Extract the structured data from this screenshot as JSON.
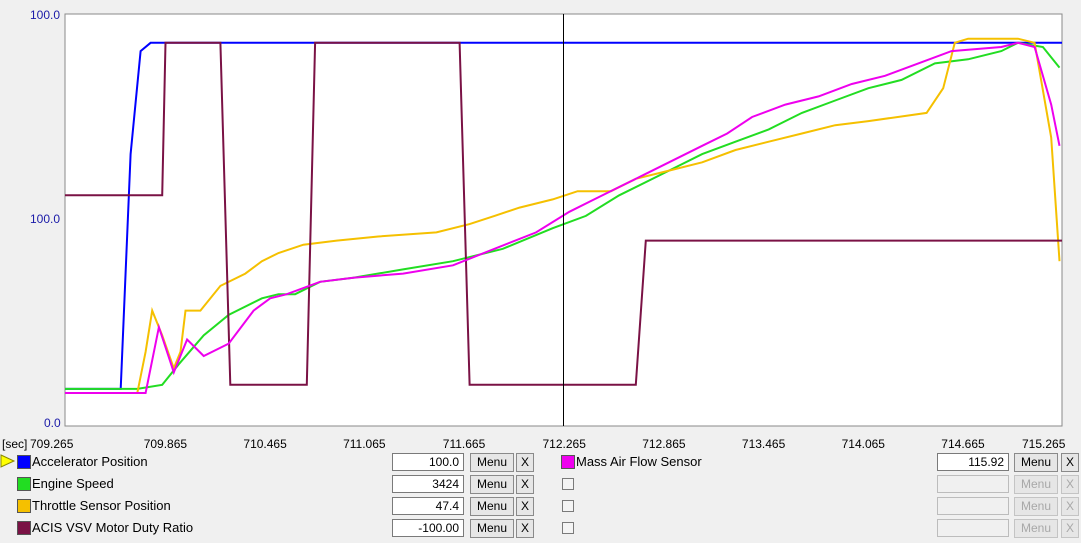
{
  "chart": {
    "y_labels": {
      "top": "100.0",
      "mid": "100.0",
      "bottom": "0.0"
    },
    "x_unit": "[sec]",
    "x_ticks": [
      "709.265",
      "709.865",
      "710.465",
      "711.065",
      "711.665",
      "712.265",
      "712.865",
      "713.465",
      "714.065",
      "714.665",
      "715.265"
    ],
    "colors": {
      "accelerator": "#0000ff",
      "engine": "#22dd22",
      "throttle": "#f5c000",
      "acis": "#7a1245",
      "maf": "#ee00ee",
      "cursor": "#000000"
    }
  },
  "chart_data": {
    "type": "line",
    "xlabel": "[sec]",
    "xlim": [
      709.265,
      715.265
    ],
    "x_ticks": [
      709.265,
      709.865,
      710.465,
      711.065,
      711.665,
      712.265,
      712.865,
      713.465,
      714.065,
      714.665,
      715.265
    ],
    "y_tick_labels": [
      "100.0",
      "100.0",
      "0.0"
    ],
    "cursor_x": 712.265,
    "series": [
      {
        "name": "Accelerator Position",
        "color": "#0000ff",
        "points": [
          [
            709.265,
            9
          ],
          [
            709.6,
            9
          ],
          [
            709.66,
            66
          ],
          [
            709.72,
            91
          ],
          [
            709.78,
            93
          ],
          [
            710.5,
            93
          ],
          [
            713.0,
            93
          ],
          [
            715.265,
            93
          ]
        ]
      },
      {
        "name": "Engine Speed",
        "color": "#22dd22",
        "points": [
          [
            709.265,
            9
          ],
          [
            709.7,
            9
          ],
          [
            709.85,
            10
          ],
          [
            709.95,
            15
          ],
          [
            710.1,
            22
          ],
          [
            710.25,
            27
          ],
          [
            710.45,
            31
          ],
          [
            710.55,
            32
          ],
          [
            710.65,
            32
          ],
          [
            710.8,
            35
          ],
          [
            711.0,
            36
          ],
          [
            711.3,
            38
          ],
          [
            711.6,
            40
          ],
          [
            711.9,
            43
          ],
          [
            712.2,
            48
          ],
          [
            712.4,
            51
          ],
          [
            712.6,
            56
          ],
          [
            712.9,
            62
          ],
          [
            713.1,
            66
          ],
          [
            713.3,
            69
          ],
          [
            713.5,
            72
          ],
          [
            713.7,
            76
          ],
          [
            713.9,
            79
          ],
          [
            714.1,
            82
          ],
          [
            714.3,
            84
          ],
          [
            714.5,
            88
          ],
          [
            714.7,
            89
          ],
          [
            714.9,
            91
          ],
          [
            715.0,
            93
          ],
          [
            715.15,
            92
          ],
          [
            715.25,
            87
          ]
        ]
      },
      {
        "name": "Throttle Sensor Position",
        "color": "#f5c000",
        "points": [
          [
            709.265,
            8
          ],
          [
            709.7,
            8
          ],
          [
            709.75,
            18
          ],
          [
            709.79,
            28
          ],
          [
            709.85,
            22
          ],
          [
            709.92,
            14
          ],
          [
            709.96,
            18
          ],
          [
            709.99,
            28
          ],
          [
            710.08,
            28
          ],
          [
            710.2,
            34
          ],
          [
            710.35,
            37
          ],
          [
            710.45,
            40
          ],
          [
            710.55,
            42
          ],
          [
            710.7,
            44
          ],
          [
            710.9,
            45
          ],
          [
            711.15,
            46
          ],
          [
            711.5,
            47
          ],
          [
            711.7,
            49
          ],
          [
            711.85,
            51
          ],
          [
            712.0,
            53
          ],
          [
            712.2,
            55
          ],
          [
            712.35,
            57
          ],
          [
            712.55,
            57
          ],
          [
            712.7,
            60
          ],
          [
            712.9,
            62
          ],
          [
            713.1,
            64
          ],
          [
            713.3,
            67
          ],
          [
            713.5,
            69
          ],
          [
            713.7,
            71
          ],
          [
            713.9,
            73
          ],
          [
            714.1,
            74
          ],
          [
            714.45,
            76
          ],
          [
            714.55,
            82
          ],
          [
            714.62,
            93
          ],
          [
            714.7,
            94
          ],
          [
            715.0,
            94
          ],
          [
            715.1,
            93
          ],
          [
            715.2,
            70
          ],
          [
            715.25,
            40
          ]
        ]
      },
      {
        "name": "ACIS VSV Motor Duty Ratio",
        "color": "#7a1245",
        "points": [
          [
            709.265,
            56
          ],
          [
            709.85,
            56
          ],
          [
            709.87,
            93
          ],
          [
            710.2,
            93
          ],
          [
            710.26,
            10
          ],
          [
            710.72,
            10
          ],
          [
            710.77,
            93
          ],
          [
            711.64,
            93
          ],
          [
            711.7,
            10
          ],
          [
            712.7,
            10
          ],
          [
            712.76,
            45
          ],
          [
            715.265,
            45
          ]
        ]
      },
      {
        "name": "Mass Air Flow Sensor",
        "color": "#ee00ee",
        "points": [
          [
            709.265,
            8
          ],
          [
            709.75,
            8
          ],
          [
            709.83,
            24
          ],
          [
            709.92,
            13
          ],
          [
            710.0,
            21
          ],
          [
            710.1,
            17
          ],
          [
            710.25,
            20
          ],
          [
            710.4,
            28
          ],
          [
            710.5,
            31
          ],
          [
            710.6,
            32
          ],
          [
            710.8,
            35
          ],
          [
            711.0,
            36
          ],
          [
            711.3,
            37
          ],
          [
            711.6,
            39
          ],
          [
            711.85,
            43
          ],
          [
            712.1,
            47
          ],
          [
            712.3,
            52
          ],
          [
            712.45,
            55
          ],
          [
            712.6,
            58
          ],
          [
            712.75,
            61
          ],
          [
            712.9,
            64
          ],
          [
            713.1,
            68
          ],
          [
            713.25,
            71
          ],
          [
            713.4,
            75
          ],
          [
            713.6,
            78
          ],
          [
            713.8,
            80
          ],
          [
            714.0,
            83
          ],
          [
            714.2,
            85
          ],
          [
            714.4,
            88
          ],
          [
            714.6,
            91
          ],
          [
            714.9,
            92
          ],
          [
            715.0,
            93
          ],
          [
            715.1,
            92
          ],
          [
            715.2,
            78
          ],
          [
            715.25,
            68
          ]
        ]
      }
    ]
  },
  "legend": {
    "left_rows": [
      {
        "label": "Accelerator Position",
        "value": "100.0",
        "menu": "Menu",
        "close": "X",
        "color": "#0000ff"
      },
      {
        "label": "Engine Speed",
        "value": "3424",
        "menu": "Menu",
        "close": "X",
        "color": "#22dd22"
      },
      {
        "label": "Throttle Sensor Position",
        "value": "47.4",
        "menu": "Menu",
        "close": "X",
        "color": "#f5c000"
      },
      {
        "label": "ACIS VSV Motor Duty Ratio",
        "value": "-100.00",
        "menu": "Menu",
        "close": "X",
        "color": "#7a1245"
      }
    ],
    "right_rows": [
      {
        "label": "Mass Air Flow Sensor",
        "value": "115.92",
        "menu": "Menu",
        "close": "X",
        "color": "#ee00ee",
        "enabled": true
      },
      {
        "label": "",
        "value": "",
        "menu": "Menu",
        "close": "X",
        "enabled": false
      },
      {
        "label": "",
        "value": "",
        "menu": "Menu",
        "close": "X",
        "enabled": false
      },
      {
        "label": "",
        "value": "",
        "menu": "Menu",
        "close": "X",
        "enabled": false
      }
    ]
  }
}
